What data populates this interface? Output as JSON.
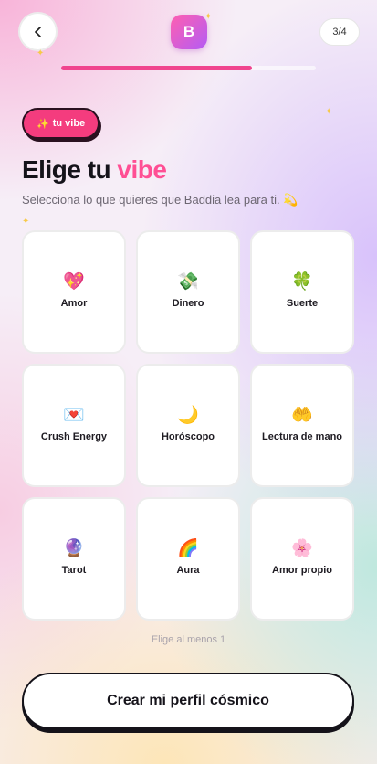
{
  "header": {
    "back_icon": "chevron-left-icon",
    "logo_letter": "B",
    "step": "3/4",
    "progress": 0.75
  },
  "tag": {
    "icon": "sparkles-icon",
    "emoji": "✨",
    "label": "tu vibe"
  },
  "title": {
    "prefix": "Elige tu ",
    "accent": "vibe"
  },
  "subtitle": "Selecciona lo que quieres que Baddia lea para ti. 💫",
  "options": [
    {
      "emoji": "💖",
      "icon": "sparkling-heart-icon",
      "label": "Amor"
    },
    {
      "emoji": "💸",
      "icon": "money-wings-icon",
      "label": "Dinero"
    },
    {
      "emoji": "🍀",
      "icon": "four-leaf-clover-icon",
      "label": "Suerte"
    },
    {
      "emoji": "💌",
      "icon": "love-letter-icon",
      "label": "Crush Energy"
    },
    {
      "emoji": "🌙",
      "icon": "crescent-moon-icon",
      "label": "Horóscopo"
    },
    {
      "emoji": "🤲",
      "icon": "palms-up-icon",
      "label": "Lectura de mano"
    },
    {
      "emoji": "🔮",
      "icon": "crystal-ball-icon",
      "label": "Tarot"
    },
    {
      "emoji": "🌈",
      "icon": "rainbow-icon",
      "label": "Aura"
    },
    {
      "emoji": "🌸",
      "icon": "cherry-blossom-icon",
      "label": "Amor propio"
    }
  ],
  "hint": "Elige al menos 1",
  "cta_label": "Crear mi perfil cósmico",
  "colors": {
    "accent": "#ff4f94",
    "chip": "#f43c7e",
    "progress": "#f0458e",
    "spark": "#f7c948"
  }
}
